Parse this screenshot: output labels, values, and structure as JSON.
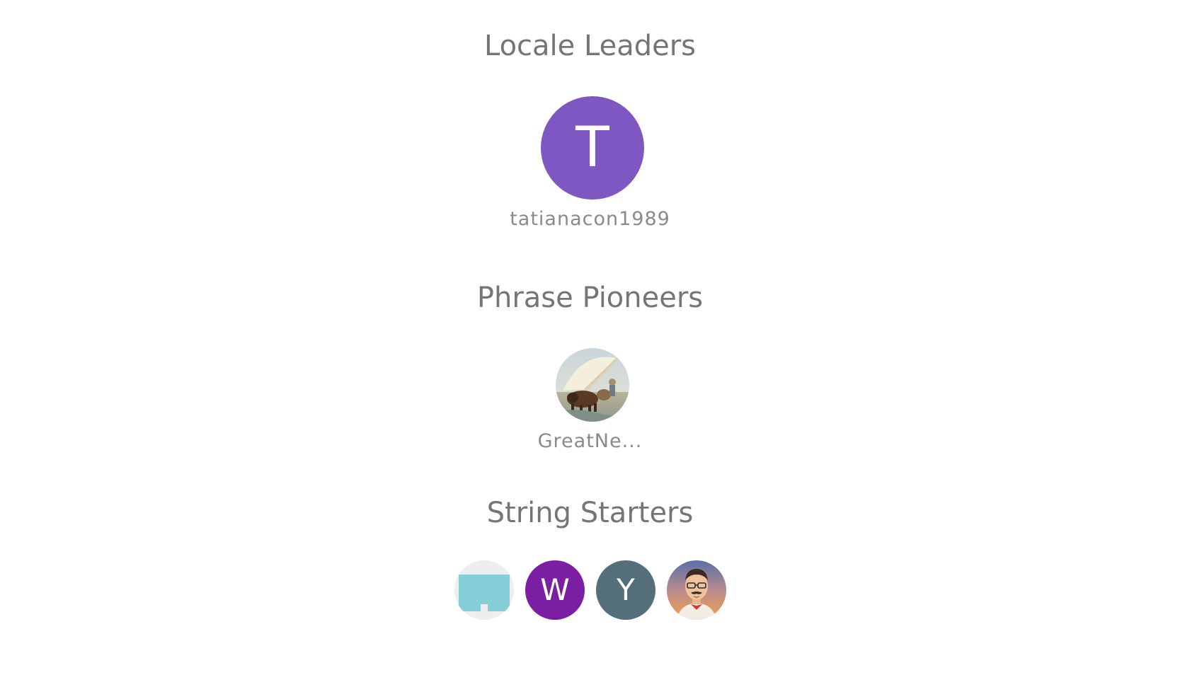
{
  "sections": [
    {
      "title": "Locale Leaders",
      "users": [
        {
          "username": "tatianacon1989",
          "initial": "T",
          "color": "#7e57c2",
          "avatar_type": "letter"
        }
      ]
    },
    {
      "title": "Phrase Pioneers",
      "users": [
        {
          "username": "GreatNe...",
          "avatar_type": "painting-image"
        }
      ]
    },
    {
      "title": "String Starters",
      "users": [
        {
          "avatar_type": "default-image"
        },
        {
          "initial": "W",
          "color": "#7b1fa2",
          "avatar_type": "letter"
        },
        {
          "initial": "Y",
          "color": "#546e7a",
          "avatar_type": "letter"
        },
        {
          "avatar_type": "cartoon-man-image"
        }
      ]
    }
  ],
  "colors": {
    "title_text": "#757575",
    "username_text": "#8a8a8a",
    "background": "#ffffff"
  }
}
